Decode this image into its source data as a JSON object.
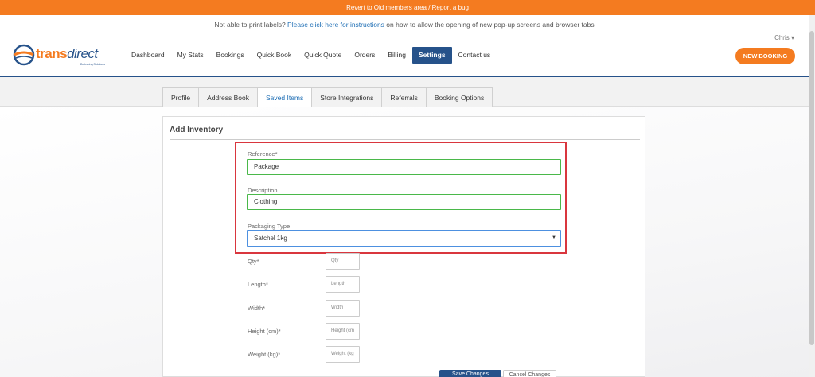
{
  "banner": {
    "text": "Revert to Old members area / Report a bug"
  },
  "notice": {
    "prefix": "Not able to print labels? ",
    "link": "Please click here for instructions",
    "suffix": " on how to allow the opening of new pop-up screens and browser tabs"
  },
  "header": {
    "user_name": "Chris",
    "logo": {
      "word1": "trans",
      "word2": "direct",
      "tagline": "Delivering Solutions"
    },
    "nav": [
      "Dashboard",
      "My Stats",
      "Bookings",
      "Quick Book",
      "Quick Quote",
      "Orders",
      "Billing",
      "Settings",
      "Contact us"
    ],
    "active_nav": "Settings",
    "new_booking_label": "NEW BOOKING"
  },
  "tabs": [
    "Profile",
    "Address Book",
    "Saved Items",
    "Store Integrations",
    "Referrals",
    "Booking Options"
  ],
  "active_tab": "Saved Items",
  "form": {
    "title": "Add Inventory",
    "reference": {
      "label": "Reference*",
      "value": "Package"
    },
    "description": {
      "label": "Description",
      "value": "Clothing"
    },
    "packaging_type": {
      "label": "Packaging Type",
      "value": "Satchel 1kg"
    },
    "qty": {
      "label": "Qty*",
      "placeholder": "Qty"
    },
    "length": {
      "label": "Length*",
      "placeholder": "Length"
    },
    "width": {
      "label": "Width*",
      "placeholder": "Width"
    },
    "height": {
      "label": "Height (cm)*",
      "placeholder": "Height (cm"
    },
    "weight": {
      "label": "Weight (kg)*",
      "placeholder": "Weight (kg"
    },
    "save_label": "Save Changes",
    "cancel_label": "Cancel Changes"
  },
  "colors": {
    "brand_orange": "#f47b20",
    "brand_blue": "#26528a",
    "link_blue": "#1f6fb5",
    "valid_green": "#4ab84a",
    "highlight_red": "#d9363e"
  }
}
